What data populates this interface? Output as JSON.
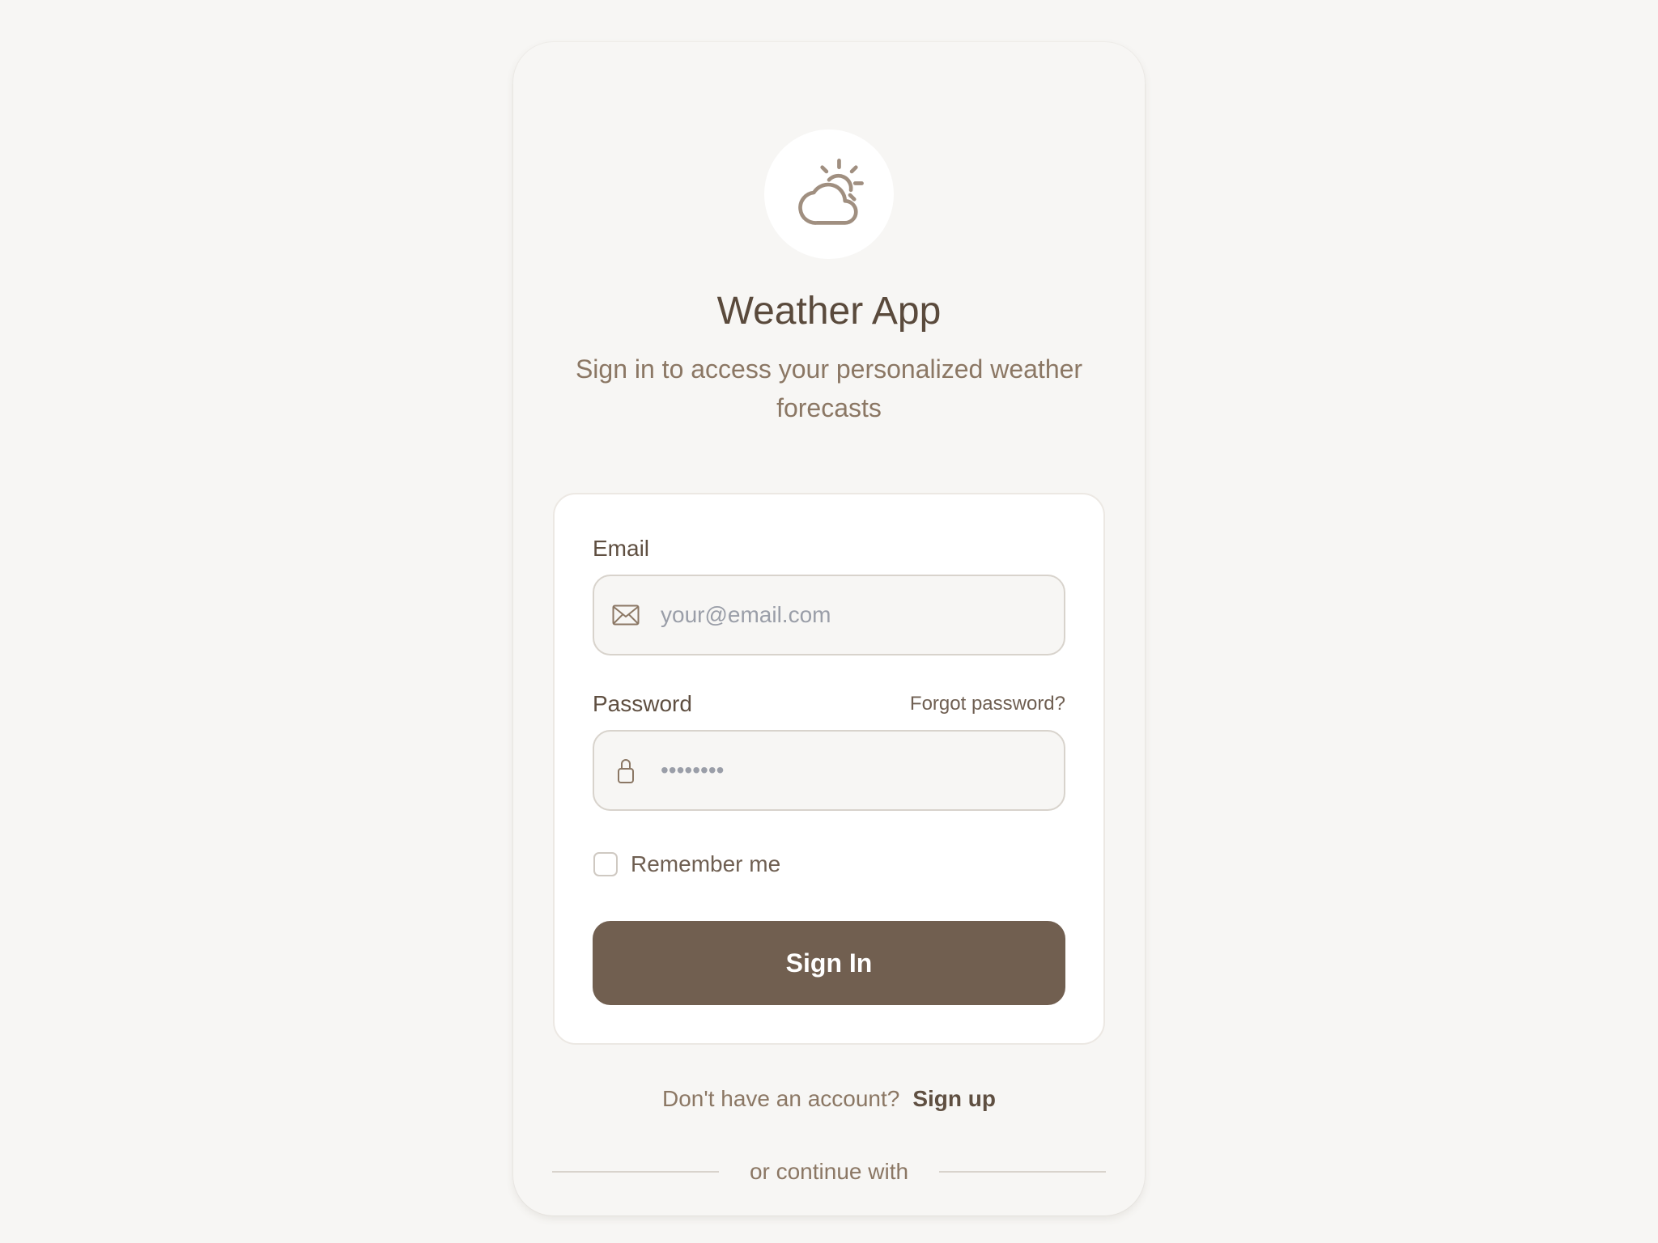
{
  "app": {
    "title": "Weather App",
    "subtitle": "Sign in to access your personalized weather forecasts",
    "logo_icon": "partly-cloudy-icon"
  },
  "form": {
    "email_label": "Email",
    "email_placeholder": "your@email.com",
    "email_icon": "mail-icon",
    "password_label": "Password",
    "password_value": "••••••••",
    "password_icon": "lock-icon",
    "forgot_link": "Forgot password?",
    "remember_label": "Remember me",
    "remember_checked": false,
    "submit_label": "Sign In"
  },
  "footer": {
    "signup_prompt": "Don't have an account?",
    "signup_link": "Sign up",
    "divider_text": "or continue with"
  },
  "colors": {
    "background": "#f7f6f4",
    "primary_button": "#715f50",
    "title_text": "#5a4a3c",
    "muted_text": "#8b7764"
  }
}
